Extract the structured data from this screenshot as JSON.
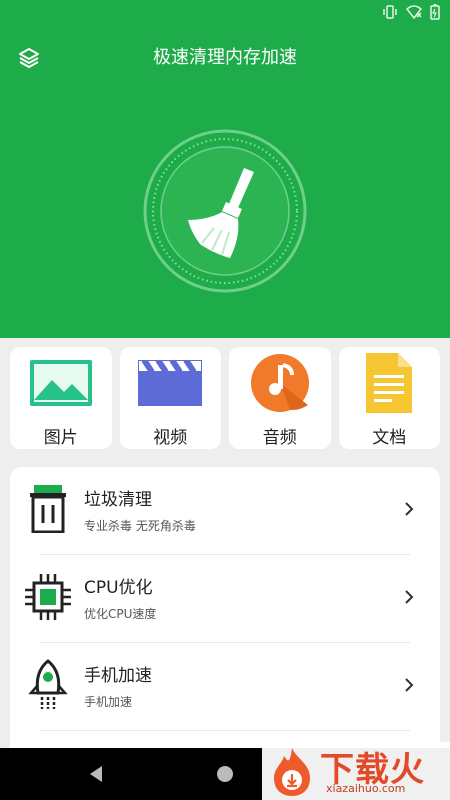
{
  "header": {
    "title": "极速清理内存加速",
    "bg_color": "#1eab49"
  },
  "status_icons": [
    "vibrate-icon",
    "wifi-off-icon",
    "battery-icon"
  ],
  "categories": [
    {
      "label": "图片",
      "icon": "image-icon",
      "color": "#26c28a"
    },
    {
      "label": "视频",
      "icon": "video-icon",
      "color": "#5d6bd6"
    },
    {
      "label": "音频",
      "icon": "audio-icon",
      "color": "#f07a2a"
    },
    {
      "label": "文档",
      "icon": "document-icon",
      "color": "#f6c532"
    }
  ],
  "features": [
    {
      "title": "垃圾清理",
      "subtitle": "专业杀毒 无死角杀毒",
      "icon": "trash-icon"
    },
    {
      "title": "CPU优化",
      "subtitle": "优化CPU速度",
      "icon": "cpu-icon"
    },
    {
      "title": "手机加速",
      "subtitle": "手机加速",
      "icon": "rocket-icon"
    }
  ],
  "watermark": {
    "text": "下载火",
    "url_text": "xiazaihuo.com"
  }
}
